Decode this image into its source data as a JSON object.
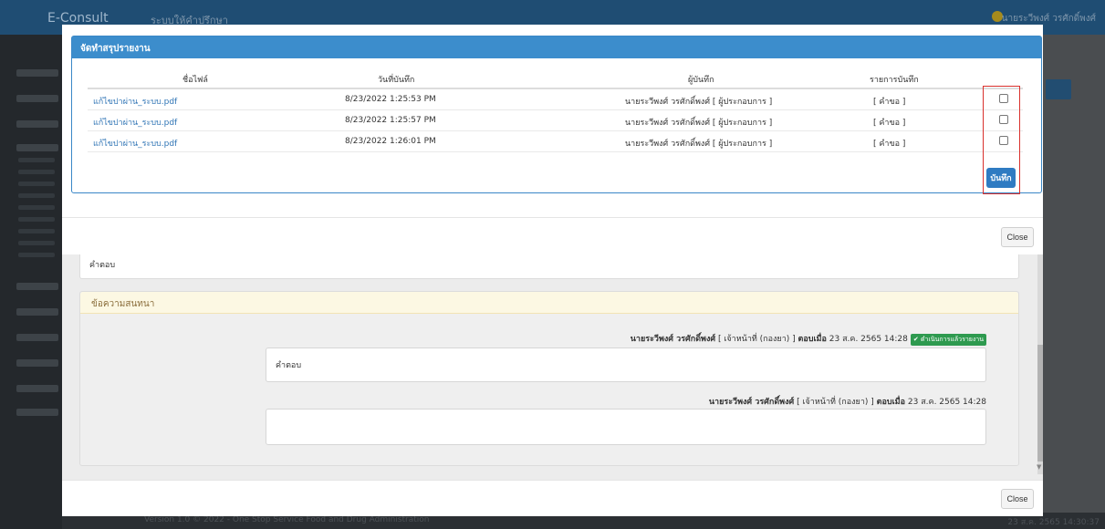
{
  "app": {
    "brand": "E-Consult",
    "crumb": "ระบบให้คำปรึกษา",
    "user": "นายระวีพงศ์ วรศักดิ์พงศ์",
    "footer": "Version 1.0 © 2022 - One Stop Service Food and Drug Administration",
    "footer_time": "23 ส.ค. 2565 14:30:37"
  },
  "summary_modal": {
    "title": "จัดทำสรุปรายงาน",
    "columns": [
      "ชื่อไฟล์",
      "วันที่บันทึก",
      "ผู้บันทึก",
      "รายการบันทึก"
    ],
    "rows": [
      {
        "file": "แก้ไขปาผ่าน_ระบบ.pdf",
        "date": "8/23/2022 1:25:53 PM",
        "by": "นายระวีพงศ์ วรศักดิ์พงศ์ [ ผู้ประกอบการ ]",
        "item": "[ คำขอ ]",
        "checked": false
      },
      {
        "file": "แก้ไขปาผ่าน_ระบบ.pdf",
        "date": "8/23/2022 1:25:57 PM",
        "by": "นายระวีพงศ์ วรศักดิ์พงศ์ [ ผู้ประกอบการ ]",
        "item": "[ คำขอ ]",
        "checked": false
      },
      {
        "file": "แก้ไขปาผ่าน_ระบบ.pdf",
        "date": "8/23/2022 1:26:01 PM",
        "by": "นายระวีพงศ์ วรศักดิ์พงศ์ [ ผู้ประกอบการ ]",
        "item": "[ คำขอ ]",
        "checked": false
      }
    ],
    "save_label": "บันทึก",
    "close_label": "Close"
  },
  "detail_modal": {
    "answer_label": "คำตอบ",
    "chat_title": "ข้อความสนทนา",
    "messages": [
      {
        "name": "นายระวีพงศ์ วรศักดิ์พงศ์",
        "role": " [ เจ้าหน้าที่ (กองยา) ] ",
        "answered": "ตอบเมื่อ",
        "date": " 23 ส.ค. 2565 14:28",
        "badge": "✔ ดำเนินการแล้วรายงาน",
        "text": "คำตอบ"
      },
      {
        "name": "นายระวีพงศ์ วรศักดิ์พงศ์",
        "role": " [ เจ้าหน้าที่ (กองยา) ] ",
        "answered": "ตอบเมื่อ",
        "date": " 23 ส.ค. 2565 14:28",
        "text": ""
      }
    ],
    "close_label": "Close"
  },
  "colors": {
    "panel_header": "#3c8dcc",
    "highlight": "#d9302c",
    "save_button": "#2f7bc2"
  }
}
